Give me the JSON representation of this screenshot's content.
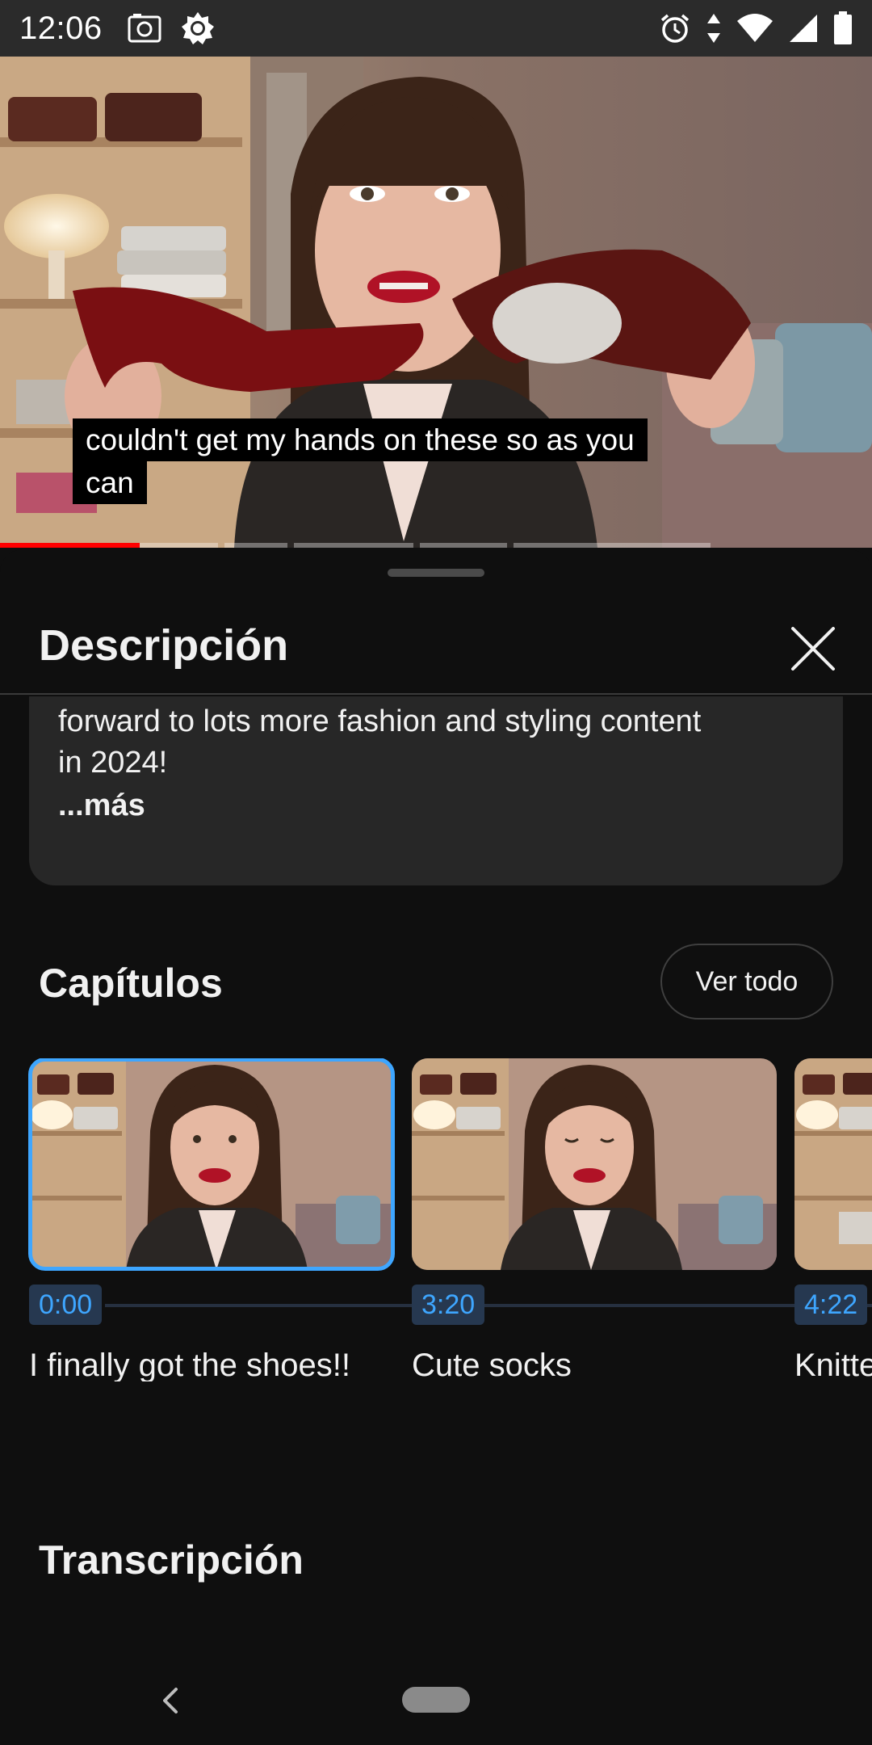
{
  "status_bar": {
    "time": "12:06",
    "left_icons": [
      "screenshot-icon",
      "brightness-icon"
    ],
    "right_icons": [
      "alarm-icon",
      "data-arrows-icon",
      "wifi-icon",
      "cell-signal-icon",
      "battery-icon"
    ]
  },
  "video": {
    "caption_lines": [
      "couldn't get my hands on these so as you",
      "can"
    ],
    "progress_played": 0.16
  },
  "sheet": {
    "title": "Descripción",
    "description": {
      "text_line1": "forward to lots more fashion and styling content",
      "text_line2": "in 2024!",
      "more_label": "...más"
    },
    "chapters_section": {
      "title": "Capítulos",
      "ver_todo_label": "Ver todo",
      "chapters": [
        {
          "timestamp": "0:00",
          "title": "I finally got the shoes!!",
          "selected": true
        },
        {
          "timestamp": "3:20",
          "title": "Cute socks",
          "selected": false
        },
        {
          "timestamp": "4:22",
          "title": "Knitte",
          "selected": false
        }
      ]
    },
    "transcript_section": {
      "title": "Transcripción"
    }
  },
  "colors": {
    "accent_blue": "#3ea6ff",
    "background": "#0f0f0f",
    "card": "#272727",
    "progress_red": "#ff0000"
  }
}
